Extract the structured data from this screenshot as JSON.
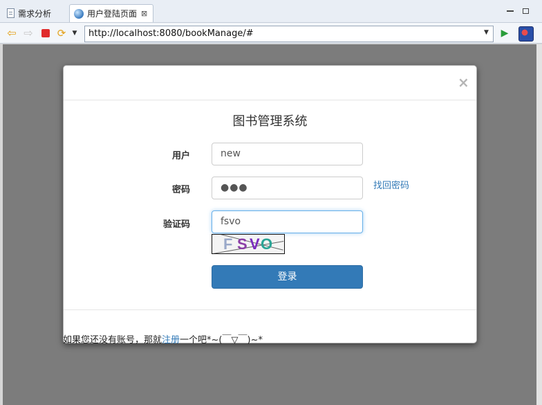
{
  "tabs": [
    {
      "label": "需求分析",
      "icon": "document-icon",
      "active": false
    },
    {
      "label": "用户登陆页面",
      "icon": "globe-icon",
      "active": true,
      "close": "⊠"
    }
  ],
  "toolbar": {
    "url": "http://localhost:8080/bookManage/#"
  },
  "modal": {
    "close": "×",
    "title": "图书管理系统",
    "user_label": "用户",
    "user_value": "new",
    "password_label": "密码",
    "password_dots": "●●●",
    "forgot_link": "找回密码",
    "captcha_label": "验证码",
    "captcha_value": "fsvo",
    "captcha_image_text": [
      "F",
      "S",
      "V",
      "O"
    ],
    "login_button": "登录",
    "footer_prefix": "如果您还没有账号，那就",
    "footer_link": "注册",
    "footer_suffix": "一个吧*~(￣▽￣)~*"
  },
  "colors": {
    "primary": "#337ab7",
    "overlay": "#7c7c7c",
    "captcha_chars": [
      "#9aa9c9",
      "#8b3fa6",
      "#7a2bbf",
      "#2aa596"
    ]
  }
}
